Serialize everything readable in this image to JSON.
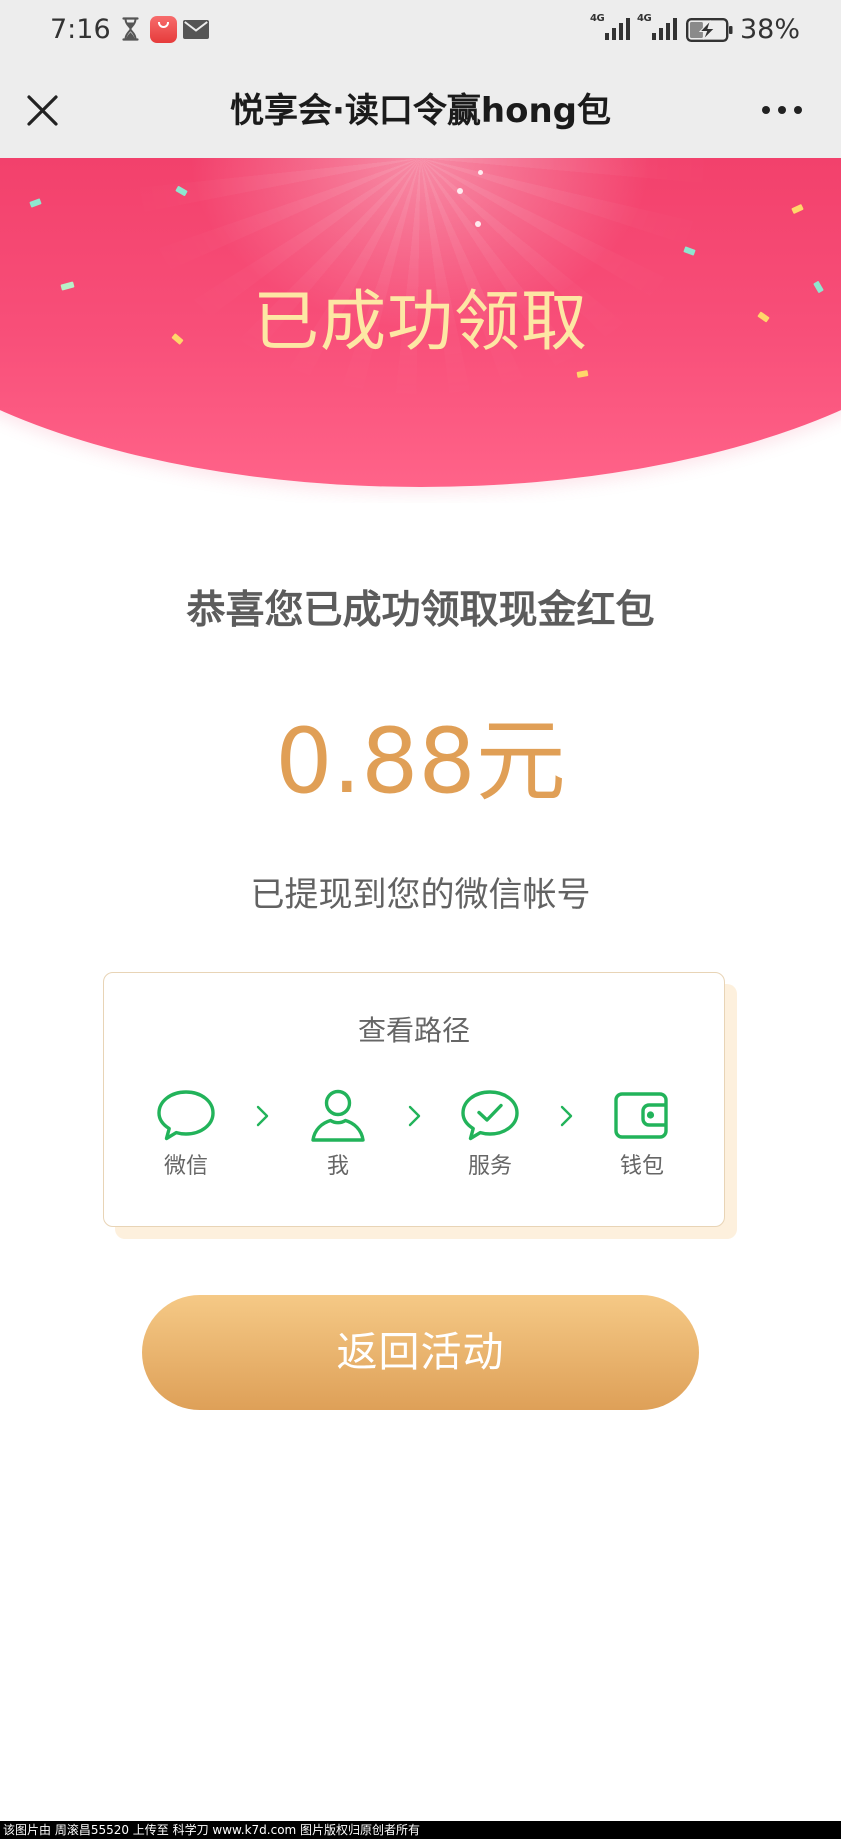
{
  "status_bar": {
    "time": "7:16",
    "left_icons": [
      "hourglass-icon",
      "huawei-app-icon",
      "mail-icon"
    ],
    "signal_1_label": "4G",
    "signal_2_label": "4G",
    "battery_icon": "battery-charging-icon",
    "battery_percent": "38%"
  },
  "nav_bar": {
    "close_icon": "close-icon",
    "title": "悦享会·读口令赢hong包",
    "more_icon": "more-dots-icon"
  },
  "banner": {
    "headline": "已成功领取"
  },
  "result": {
    "congrats_text": "恭喜您已成功领取现金红包",
    "amount": "0.88元",
    "withdraw_note": "已提现到您的微信帐号"
  },
  "path_card": {
    "title": "查看路径",
    "separator_icon": "chevron-right-icon",
    "steps": [
      {
        "label": "微信",
        "icon": "chat-bubble-icon"
      },
      {
        "label": "我",
        "icon": "person-icon"
      },
      {
        "label": "服务",
        "icon": "chat-check-icon"
      },
      {
        "label": "钱包",
        "icon": "wallet-icon"
      }
    ]
  },
  "back_button": {
    "label": "返回活动"
  },
  "watermark": {
    "text": "该图片由 周滚昌55520 上传至 科学刀 www.k7d.com 图片版权归原创者所有"
  },
  "colors": {
    "banner_top": "#f2406b",
    "banner_bottom": "#ff6389",
    "headline_gold": "#fde7a4",
    "amount_orange": "#e09f56",
    "wechat_green": "#22b35a",
    "button_top": "#f5c986",
    "button_bottom": "#dea058",
    "card_border": "#e8d4b6",
    "card_shadow": "#fdf0dd"
  }
}
